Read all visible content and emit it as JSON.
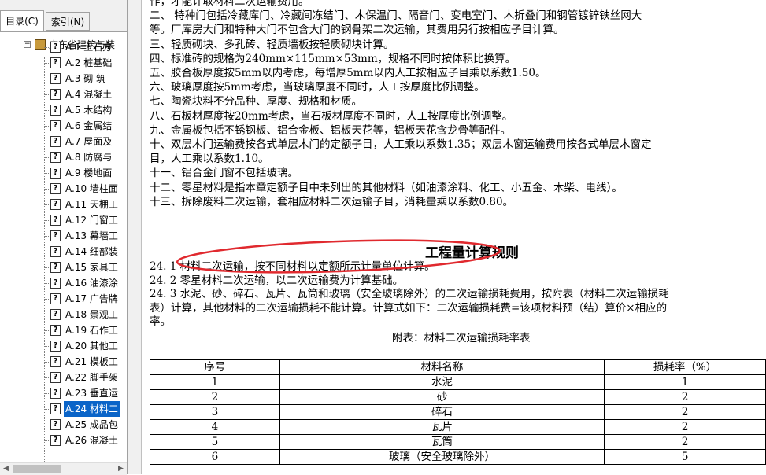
{
  "nav": {
    "tabs": [
      {
        "label": "目录(C)"
      },
      {
        "label": "索引(N)"
      }
    ],
    "root_label": "广东省建筑与装",
    "items": [
      {
        "label": "A.1  土石方"
      },
      {
        "label": "A.2  桩基础"
      },
      {
        "label": "A.3  砌  筑"
      },
      {
        "label": "A.4  混凝土"
      },
      {
        "label": "A.5  木结构"
      },
      {
        "label": "A.6  金属结"
      },
      {
        "label": "A.7  屋面及"
      },
      {
        "label": "A.8  防腐与"
      },
      {
        "label": "A.9  楼地面"
      },
      {
        "label": "A.10  墙柱面"
      },
      {
        "label": "A.11  天棚工"
      },
      {
        "label": "A.12  门窗工"
      },
      {
        "label": "A.13  幕墙工"
      },
      {
        "label": "A.14  细部装"
      },
      {
        "label": "A.15  家具工"
      },
      {
        "label": "A.16  油漆涂"
      },
      {
        "label": "A.17  广告牌"
      },
      {
        "label": "A.18  景观工"
      },
      {
        "label": "A.19  石作工"
      },
      {
        "label": "A.20  其他工"
      },
      {
        "label": "A.21  模板工"
      },
      {
        "label": "A.22  脚手架"
      },
      {
        "label": "A.23  垂直运"
      },
      {
        "label": "A.24  材料二"
      },
      {
        "label": "A.25  成品包"
      },
      {
        "label": "A.26  混凝土"
      }
    ],
    "selected_index": 23
  },
  "doc": {
    "lines": [
      "作，才能计取材料二次运输费用。",
      "    二、  特种门包括冷藏库门、冷藏间冻结门、木保温门、隔音门、变电室门、木折叠门和钢管镀锌铁丝网大",
      "等。厂库房大门和特种大门不包含大门的钢骨架二次运输，其费用另行按相应子目计算。",
      "    三、轻质砌块、多孔砖、轻质墙板按轻质砌块计算。",
      "    四、标准砖的规格为240mm×115mm×53mm，规格不同时按体积比换算。",
      "    五、胶合板厚度按5mm以内考虑，每增厚5mm以内人工按相应子目乘以系数1.50。",
      "    六、玻璃厚度按5mm考虑，当玻璃厚度不同时，人工按厚度比例调整。",
      "    七、陶瓷块料不分品种、厚度、规格和材质。",
      "    八、石板材厚度按20mm考虑，当石板材厚度不同时，人工按厚度比例调整。",
      "    九、金属板包括不锈钢板、铝合金板、铝板天花等，铝板天花含龙骨等配件。",
      "    十、双层木门运输费按各式单层木门的定额子目，人工乘以系数1.35；双层木窗运输费用按各式单层木窗定",
      "目，人工乘以系数1.10。",
      "    十一、铝合金门窗不包括玻璃。",
      "    十二、零星材料是指本章定额子目中未列出的其他材料（如油漆涂料、化工、小五金、木柴、电线）。",
      "    十三、拆除废料二次运输，套相应材料二次运输子目，消耗量乘以系数0.80。"
    ],
    "heading": "工程量计算规则",
    "rules": [
      "24. 1  材料二次运输，按不同材料以定额所示计量单位计算。",
      "24. 2  零星材料二次运输，以二次运输费为计算基础。",
      "24. 3  水泥、砂、碎石、瓦片、瓦筒和玻璃（安全玻璃除外）的二次运输损耗费用，按附表（材料二次运输损耗",
      "表）计算，其他材料的二次运输损耗不能计算。计算式如下：二次运输损耗费=该项材料预（结）算价×相应的",
      "率。"
    ],
    "table_caption": "附表：材料二次运输损耗率表",
    "table": {
      "headers": [
        "序号",
        "材料名称",
        "损耗率（%）"
      ],
      "rows": [
        [
          "1",
          "水泥",
          "1"
        ],
        [
          "2",
          "砂",
          "2"
        ],
        [
          "3",
          "碎石",
          "2"
        ],
        [
          "4",
          "瓦片",
          "2"
        ],
        [
          "5",
          "瓦筒",
          "2"
        ],
        [
          "6",
          "玻璃（安全玻璃除外）",
          "5"
        ]
      ]
    }
  },
  "colors": {
    "annotation_red": "#e0292e",
    "selection_blue": "#0a64c8"
  }
}
